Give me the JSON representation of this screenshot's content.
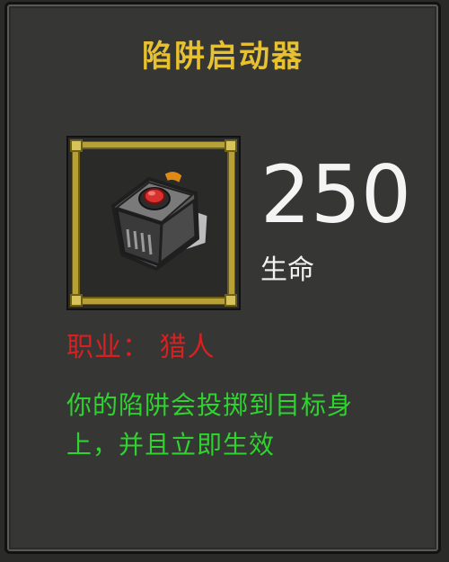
{
  "item": {
    "name": "陷阱启动器",
    "icon": "trap-launcher-icon",
    "stat_value": "250",
    "stat_label": "生命",
    "class_line": "职业： 猎人",
    "description_line1": "你的陷阱会投掷到目标身",
    "description_line2": "上，并且立即生效"
  },
  "colors": {
    "title": "#e7c12f",
    "class_text": "#d52121",
    "description_text": "#2fd32f",
    "stat_text": "#f4f4f4",
    "frame_gold": "#b7a035",
    "panel_bg": "#363634"
  }
}
